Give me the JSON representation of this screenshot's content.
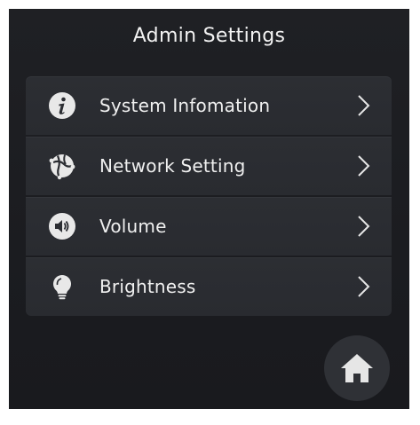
{
  "header": {
    "title": "Admin Settings"
  },
  "menu": {
    "items": [
      {
        "label": "System Infomation",
        "icon": "info-icon"
      },
      {
        "label": "Network Setting",
        "icon": "network-icon"
      },
      {
        "label": "Volume",
        "icon": "volume-icon"
      },
      {
        "label": "Brightness",
        "icon": "lightbulb-icon"
      }
    ]
  },
  "footer": {
    "home_icon": "home-icon"
  },
  "colors": {
    "background": "#1c1d21",
    "row": "#2b2d32",
    "text": "#f0f0f0",
    "icon": "#e8e8e8"
  }
}
